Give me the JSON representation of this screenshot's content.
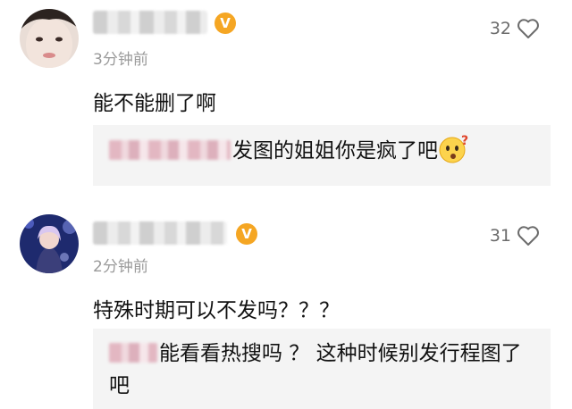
{
  "colors": {
    "vip_badge": "#f5a623",
    "timestamp": "#9a9a9a",
    "reply_background": "#f4f4f4"
  },
  "comments": [
    {
      "avatar_icon": "avatar-face-icon",
      "badge_icon": "v-verified-badge-icon",
      "time": "3分钟前",
      "likes": "32",
      "text": "能不能删了啊",
      "reply": {
        "text": "发图的姐姐你是疯了吧",
        "emoji_icon": "thinking-face-emoji-icon"
      }
    },
    {
      "avatar_icon": "avatar-concert-photo-icon",
      "badge_icon": "v-verified-badge-icon",
      "time": "2分钟前",
      "likes": "31",
      "text": "特殊时期可以不发吗？？？",
      "reply": {
        "text": "能看看热搜吗 ？ 这种时候别发行程图了吧"
      }
    }
  ]
}
